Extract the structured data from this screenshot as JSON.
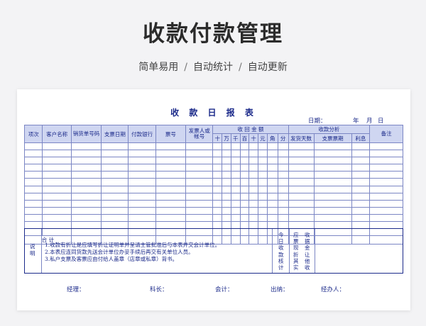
{
  "page": {
    "title": "收款付款管理",
    "tags": [
      "简单易用",
      "自动统计",
      "自动更新"
    ],
    "separator": "/"
  },
  "form": {
    "title": "收 款 日 报 表",
    "date_label": "日期：",
    "year": "年",
    "month": "月",
    "day": "日",
    "headers": {
      "seq": "项次",
      "customer": "客户名称",
      "sales_doc": "销货单号码",
      "cheque_date": "支票日期",
      "bank": "付款银行",
      "ticket_no": "票号",
      "issuer": "发票人或帐号",
      "amount_group": "收 回 金 额",
      "amount_units": [
        "十",
        "万",
        "千",
        "百",
        "十",
        "元",
        "角",
        "分"
      ],
      "analysis_group": "收款分析",
      "days": "发货天数",
      "cheque_period": "支票票期",
      "interest": "利息",
      "remarks": "备注"
    },
    "total_label": "合 计",
    "notes_label": "说明",
    "notes": [
      "1.收款有折让是应填写折让证明单并呈请主管批准后与本表并交会计单位。",
      "2.本表应连同货款先送会计单位办妥手续后再交有关单位人员。",
      "3.私户支票及客票应由付给人盖章（店章或私章）背书。"
    ],
    "summary_col1": "今日收款核计",
    "summary_col2": "应票现折其实",
    "summary_col3": "收据金让他收",
    "signatures": [
      "经理：",
      "科长：",
      "会计：",
      "出纳：",
      "经办人："
    ]
  }
}
